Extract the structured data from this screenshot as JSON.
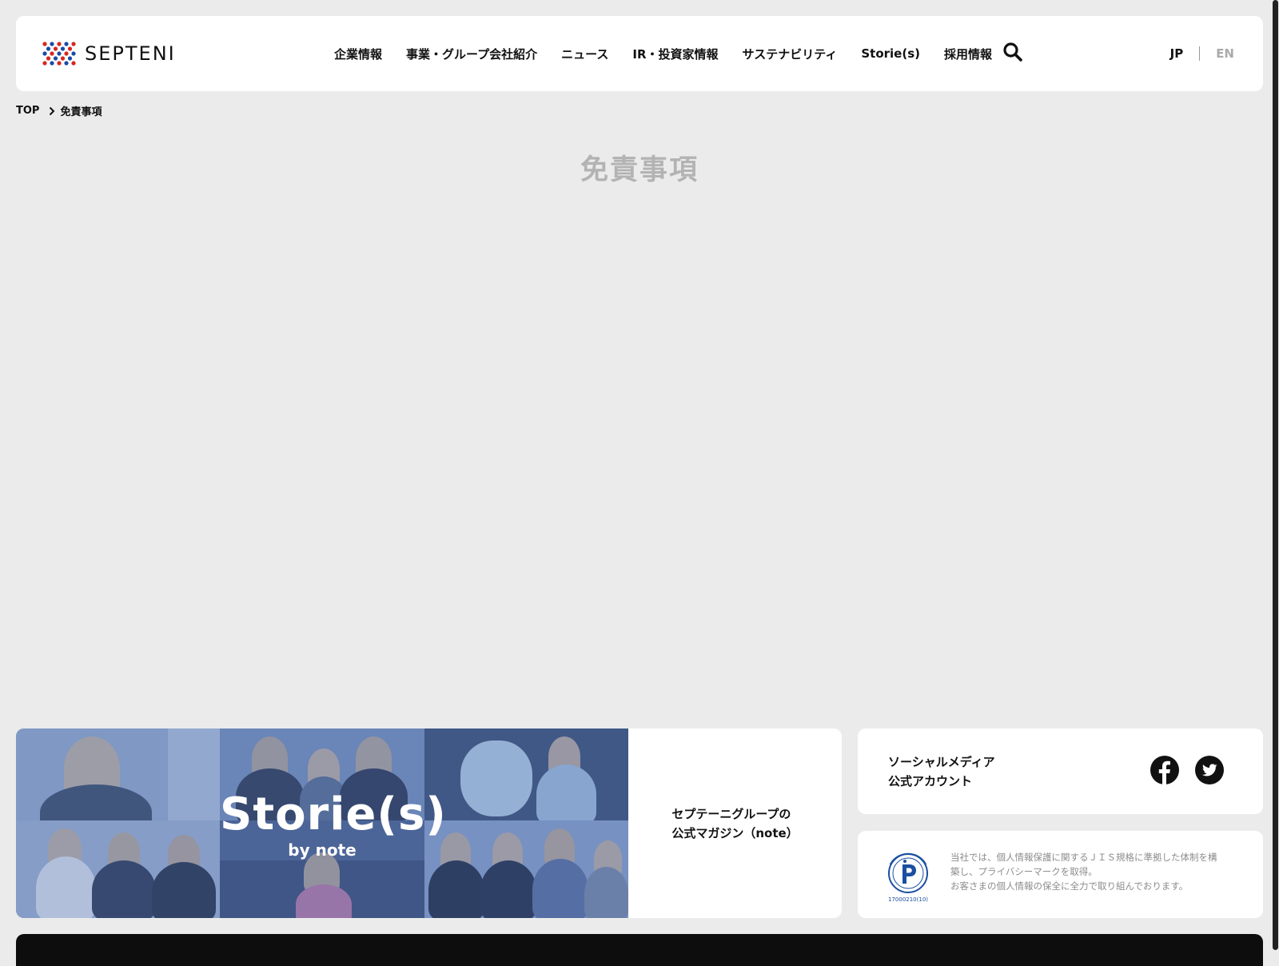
{
  "header": {
    "logo_text": "SEPTENI",
    "nav": [
      {
        "label": "企業情報"
      },
      {
        "label": "事業・グループ会社紹介"
      },
      {
        "label": "ニュース"
      },
      {
        "label": "IR・投資家情報"
      },
      {
        "label": "サステナビリティ"
      },
      {
        "label": "Storie(s)"
      },
      {
        "label": "採用情報"
      }
    ],
    "lang_jp": "JP",
    "lang_en": "EN"
  },
  "breadcrumb": {
    "top": "TOP",
    "current": "免責事項"
  },
  "page": {
    "title": "免責事項"
  },
  "stories": {
    "banner_title": "Storie(s)",
    "banner_sub": "by note",
    "text_line1": "セプテーニグループの",
    "text_line2": "公式マガジン（note）"
  },
  "social": {
    "title_line1": "ソーシャルメディア",
    "title_line2": "公式アカウント"
  },
  "privacy": {
    "line1": "当社では、個人情報保護に関するＪＩＳ規格に準拠した体制を構",
    "line2": "築し、プライバシーマークを取得。",
    "line3": "お客さまの個人情報の保全に全力で取り組んでおります。",
    "mark_number": "17000210(10)"
  },
  "colors": {
    "background": "#ebebeb",
    "title_gray": "#b3b3b3",
    "banner_blue": "#6b88b8",
    "privacy_blue": "#1a4fa0"
  }
}
